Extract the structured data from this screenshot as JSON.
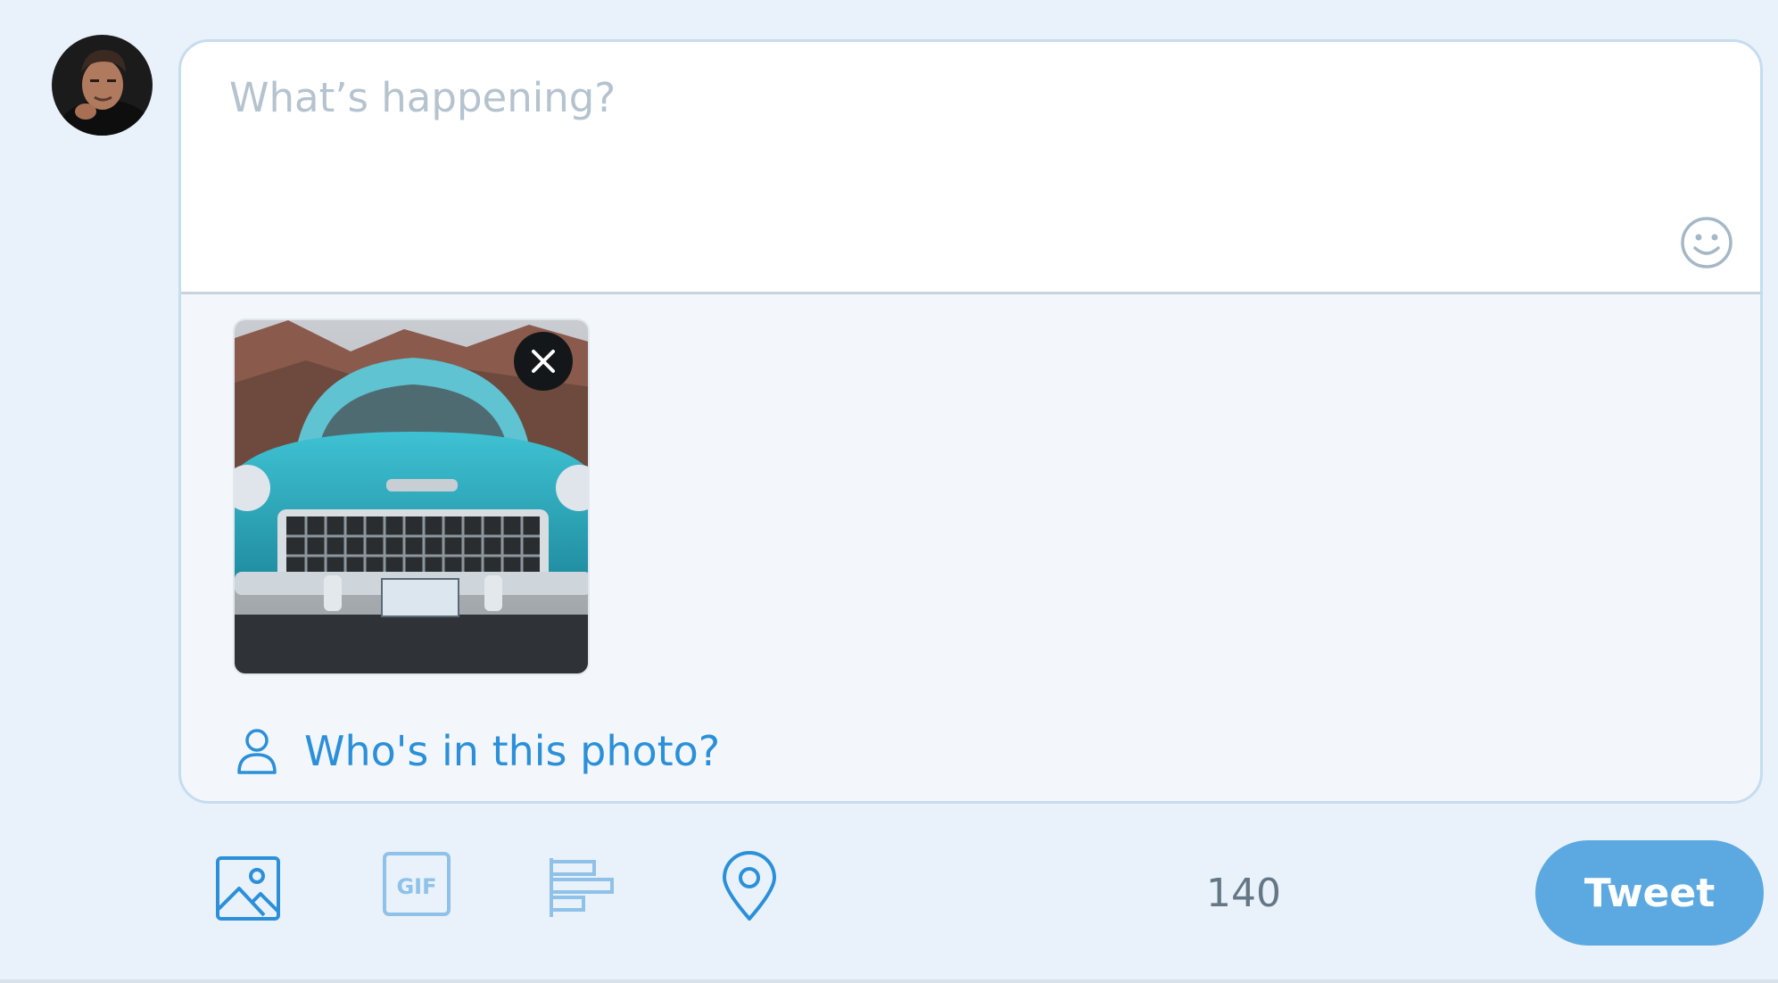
{
  "composer": {
    "placeholder": "What’s happening?",
    "text": "",
    "emoji_icon": "smiley-face-icon"
  },
  "avatar": {
    "icon": "user-photo"
  },
  "media": {
    "thumbnail_icon": "car-photo",
    "remove_icon": "close-x-icon",
    "tag_icon": "person-icon",
    "tag_label": "Who's in this photo?"
  },
  "toolbar": {
    "icons": [
      "image-icon",
      "gif-icon",
      "poll-icon",
      "location-pin-icon"
    ],
    "gif_text": "GIF",
    "char_count": "140",
    "tweet_label": "Tweet"
  },
  "colors": {
    "accent": "#5ca9e1",
    "link": "#2b90d9",
    "icon": "#7fb7e6",
    "background": "#e9f2fa"
  }
}
